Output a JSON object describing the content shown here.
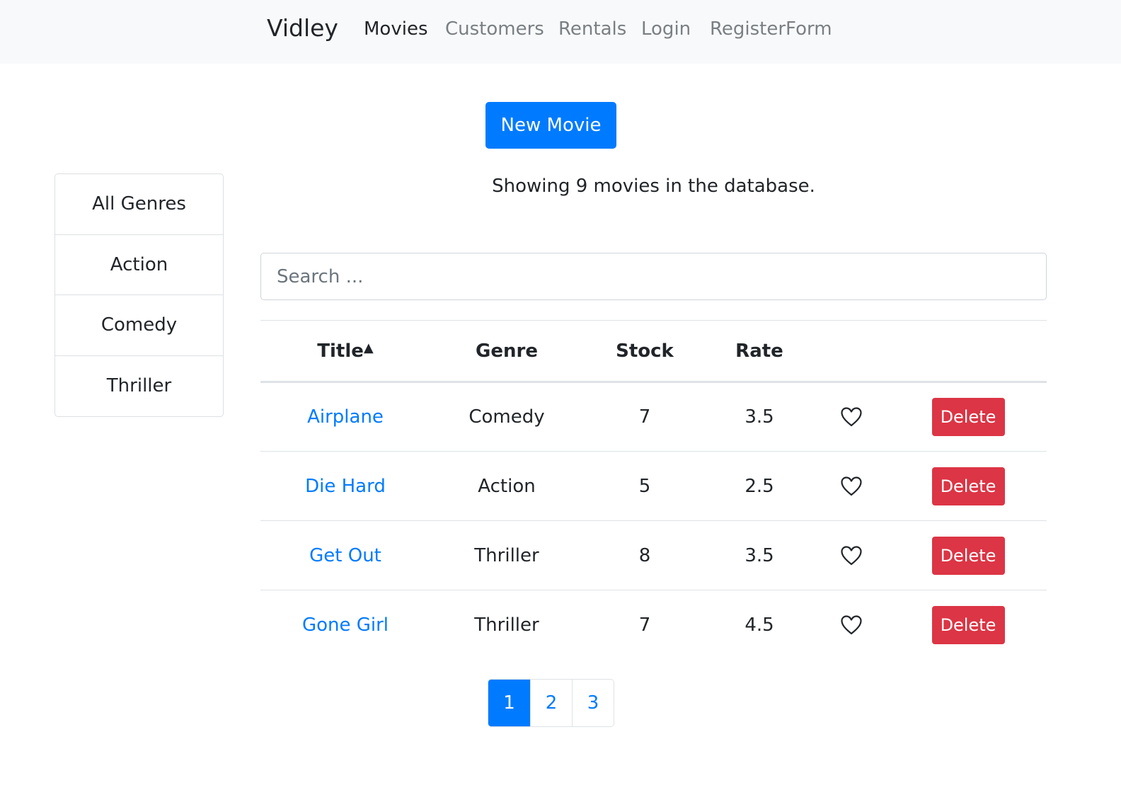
{
  "navbar": {
    "brand": "Vidley",
    "links": [
      {
        "label": "Movies",
        "active": true
      },
      {
        "label": "Customers",
        "active": false
      },
      {
        "label": "Rentals",
        "active": false
      },
      {
        "label": "Login",
        "active": false
      },
      {
        "label": "RegisterForm",
        "active": false
      }
    ]
  },
  "new_movie_label": "New Movie",
  "genres": [
    "All Genres",
    "Action",
    "Comedy",
    "Thriller"
  ],
  "count_text": "Showing 9 movies in the database.",
  "search": {
    "placeholder": "Search ...",
    "value": ""
  },
  "table": {
    "columns": [
      "Title",
      "Genre",
      "Stock",
      "Rate"
    ],
    "sort_indicator": "▲",
    "delete_label": "Delete",
    "rows": [
      {
        "title": "Airplane",
        "genre": "Comedy",
        "stock": "7",
        "rate": "3.5",
        "liked": false
      },
      {
        "title": "Die Hard",
        "genre": "Action",
        "stock": "5",
        "rate": "2.5",
        "liked": false
      },
      {
        "title": "Get Out",
        "genre": "Thriller",
        "stock": "8",
        "rate": "3.5",
        "liked": false
      },
      {
        "title": "Gone Girl",
        "genre": "Thriller",
        "stock": "7",
        "rate": "4.5",
        "liked": false
      }
    ]
  },
  "pagination": {
    "pages": [
      "1",
      "2",
      "3"
    ],
    "current": "1"
  },
  "colors": {
    "primary": "#007bff",
    "danger": "#dc3545",
    "navbar_bg": "#f8f9fa"
  }
}
